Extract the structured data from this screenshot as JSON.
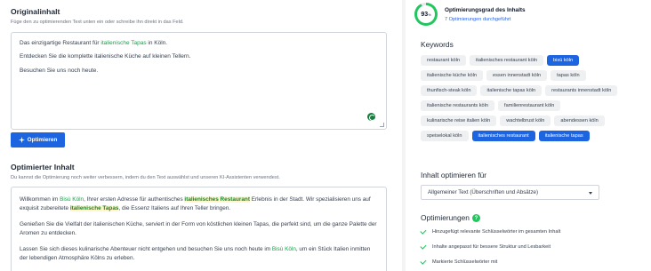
{
  "original": {
    "title": "Originalinhalt",
    "subtitle": "Füge den zu optimierenden Text unten ein oder schreibe ihn direkt in das Feld.",
    "line1_pre": "Das einzigartige Restaurant für ",
    "line1_kw": "italienische Tapas",
    "line1_post": " in Köln.",
    "line2": "Entdecken Sie die komplette italienische Küche auf kleinen Tellern.",
    "line3": "Besuchen Sie uns noch heute."
  },
  "optimize_button": {
    "label": "Optimieren",
    "icon": "sparkle-icon"
  },
  "optimized": {
    "title": "Optimierter Inhalt",
    "subtitle": "Du kannst die Optimierung noch weiter verbessern, indem du den Text auswählst und unseren KI-Assistenten verwendest.",
    "p1": [
      {
        "text": "Willkommen im ",
        "style": "plain"
      },
      {
        "text": "Bisù Köln",
        "style": "kw"
      },
      {
        "text": ", Ihrer ersten Adresse für authentisches ",
        "style": "plain"
      },
      {
        "text": "italienisches Restaurant",
        "style": "kwb"
      },
      {
        "text": " Erlebnis in der Stadt. Wir spezialisieren uns auf exquisit zubereitete ",
        "style": "plain"
      },
      {
        "text": "italienische Tapas",
        "style": "kwb"
      },
      {
        "text": ", die Essenz Italiens auf Ihren Teller bringen.",
        "style": "plain"
      }
    ],
    "p2": "Genießen Sie die Vielfalt der italienischen Küche, serviert in der Form von köstlichen kleinen Tapas, die perfekt sind, um die ganze Palette der Aromen zu entdecken.",
    "p3": [
      {
        "text": "Lassen Sie sich dieses kulinarische Abenteuer nicht entgehen und besuchen Sie uns noch heute im ",
        "style": "plain"
      },
      {
        "text": "Bisù Köln",
        "style": "kw"
      },
      {
        "text": ", um ein Stück Italien inmitten der lebendigen Atmosphäre Kölns zu erleben.",
        "style": "plain"
      }
    ]
  },
  "score": {
    "value": "93",
    "unit": "%",
    "fraction": 0.93,
    "title": "Optimierungsgrad des Inhalts",
    "link": "7 Optimierungen durchgeführt"
  },
  "keywords": {
    "title": "Keywords",
    "items": [
      {
        "label": "restaurant köln",
        "active": false
      },
      {
        "label": "italienisches restaurant köln",
        "active": false
      },
      {
        "label": "bisù köln",
        "active": true
      },
      {
        "label": "italienische küche köln",
        "active": false
      },
      {
        "label": "essen innenstadt köln",
        "active": false
      },
      {
        "label": "tapas köln",
        "active": false
      },
      {
        "label": "thunfisch-steak köln",
        "active": false
      },
      {
        "label": "italienische tapas köln",
        "active": false
      },
      {
        "label": "restaurants innenstadt köln",
        "active": false
      },
      {
        "label": "italienische restaurants köln",
        "active": false
      },
      {
        "label": "familienrestaurant köln",
        "active": false
      },
      {
        "label": "kulinarische reise italien köln",
        "active": false
      },
      {
        "label": "wachtelbrust köln",
        "active": false
      },
      {
        "label": "abendessen köln",
        "active": false
      },
      {
        "label": "speiselokal köln",
        "active": false
      },
      {
        "label": "italienisches restaurant",
        "active": true
      },
      {
        "label": "italienische tapas",
        "active": true
      }
    ]
  },
  "mode": {
    "title": "Inhalt optimieren für",
    "selected": "Allgemeiner Text (Überschriften und Absätze)"
  },
  "optimizations": {
    "title": "Optimierungen",
    "help": "?",
    "items": [
      "Hinzugefügt relevante Schlüsselwörter im gesamten Inhalt",
      "Inhalte angepasst für bessere Struktur und Lesbarkeit",
      "Markierte Schlüsselwörter mit"
    ]
  },
  "colors": {
    "primary": "#1d64e0",
    "keyword": "#16a34a",
    "score": "#22c55e"
  }
}
